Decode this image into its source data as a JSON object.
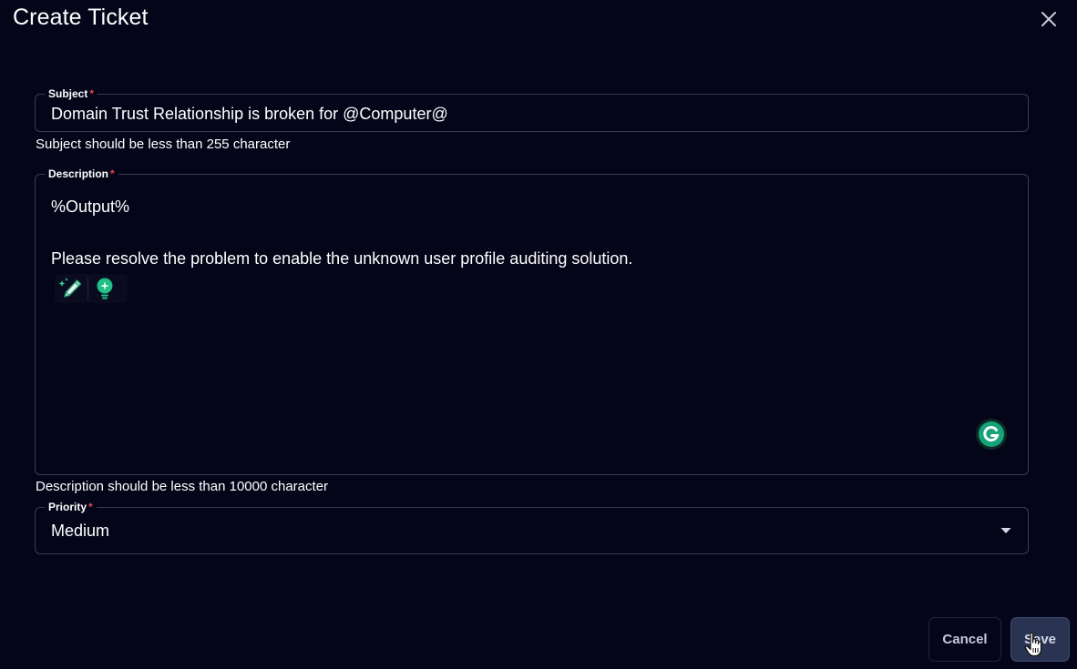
{
  "dialog": {
    "title": "Create Ticket"
  },
  "subject": {
    "label": "Subject",
    "required_marker": "*",
    "value": "Domain Trust Relationship is broken for @Computer@",
    "helper": "Subject should be less than 255 character"
  },
  "description": {
    "label": "Description",
    "required_marker": "*",
    "lines": [
      "%Output%",
      "Please resolve the problem to enable the unknown user profile auditing solution."
    ],
    "helper": "Description should be less than 10000 character",
    "assist_icons": [
      "magic-pencil-icon",
      "lightbulb-icon"
    ],
    "grammarly_icon": "grammarly-icon"
  },
  "priority": {
    "label": "Priority",
    "required_marker": "*",
    "value": "Medium"
  },
  "actions": {
    "cancel_label": "Cancel",
    "save_label": "Save"
  },
  "colors": {
    "background": "#05051a",
    "border": "#3a3a52",
    "required": "#e04646",
    "accent_green": "#1a9e6a",
    "save_bg": "#2a3452"
  }
}
